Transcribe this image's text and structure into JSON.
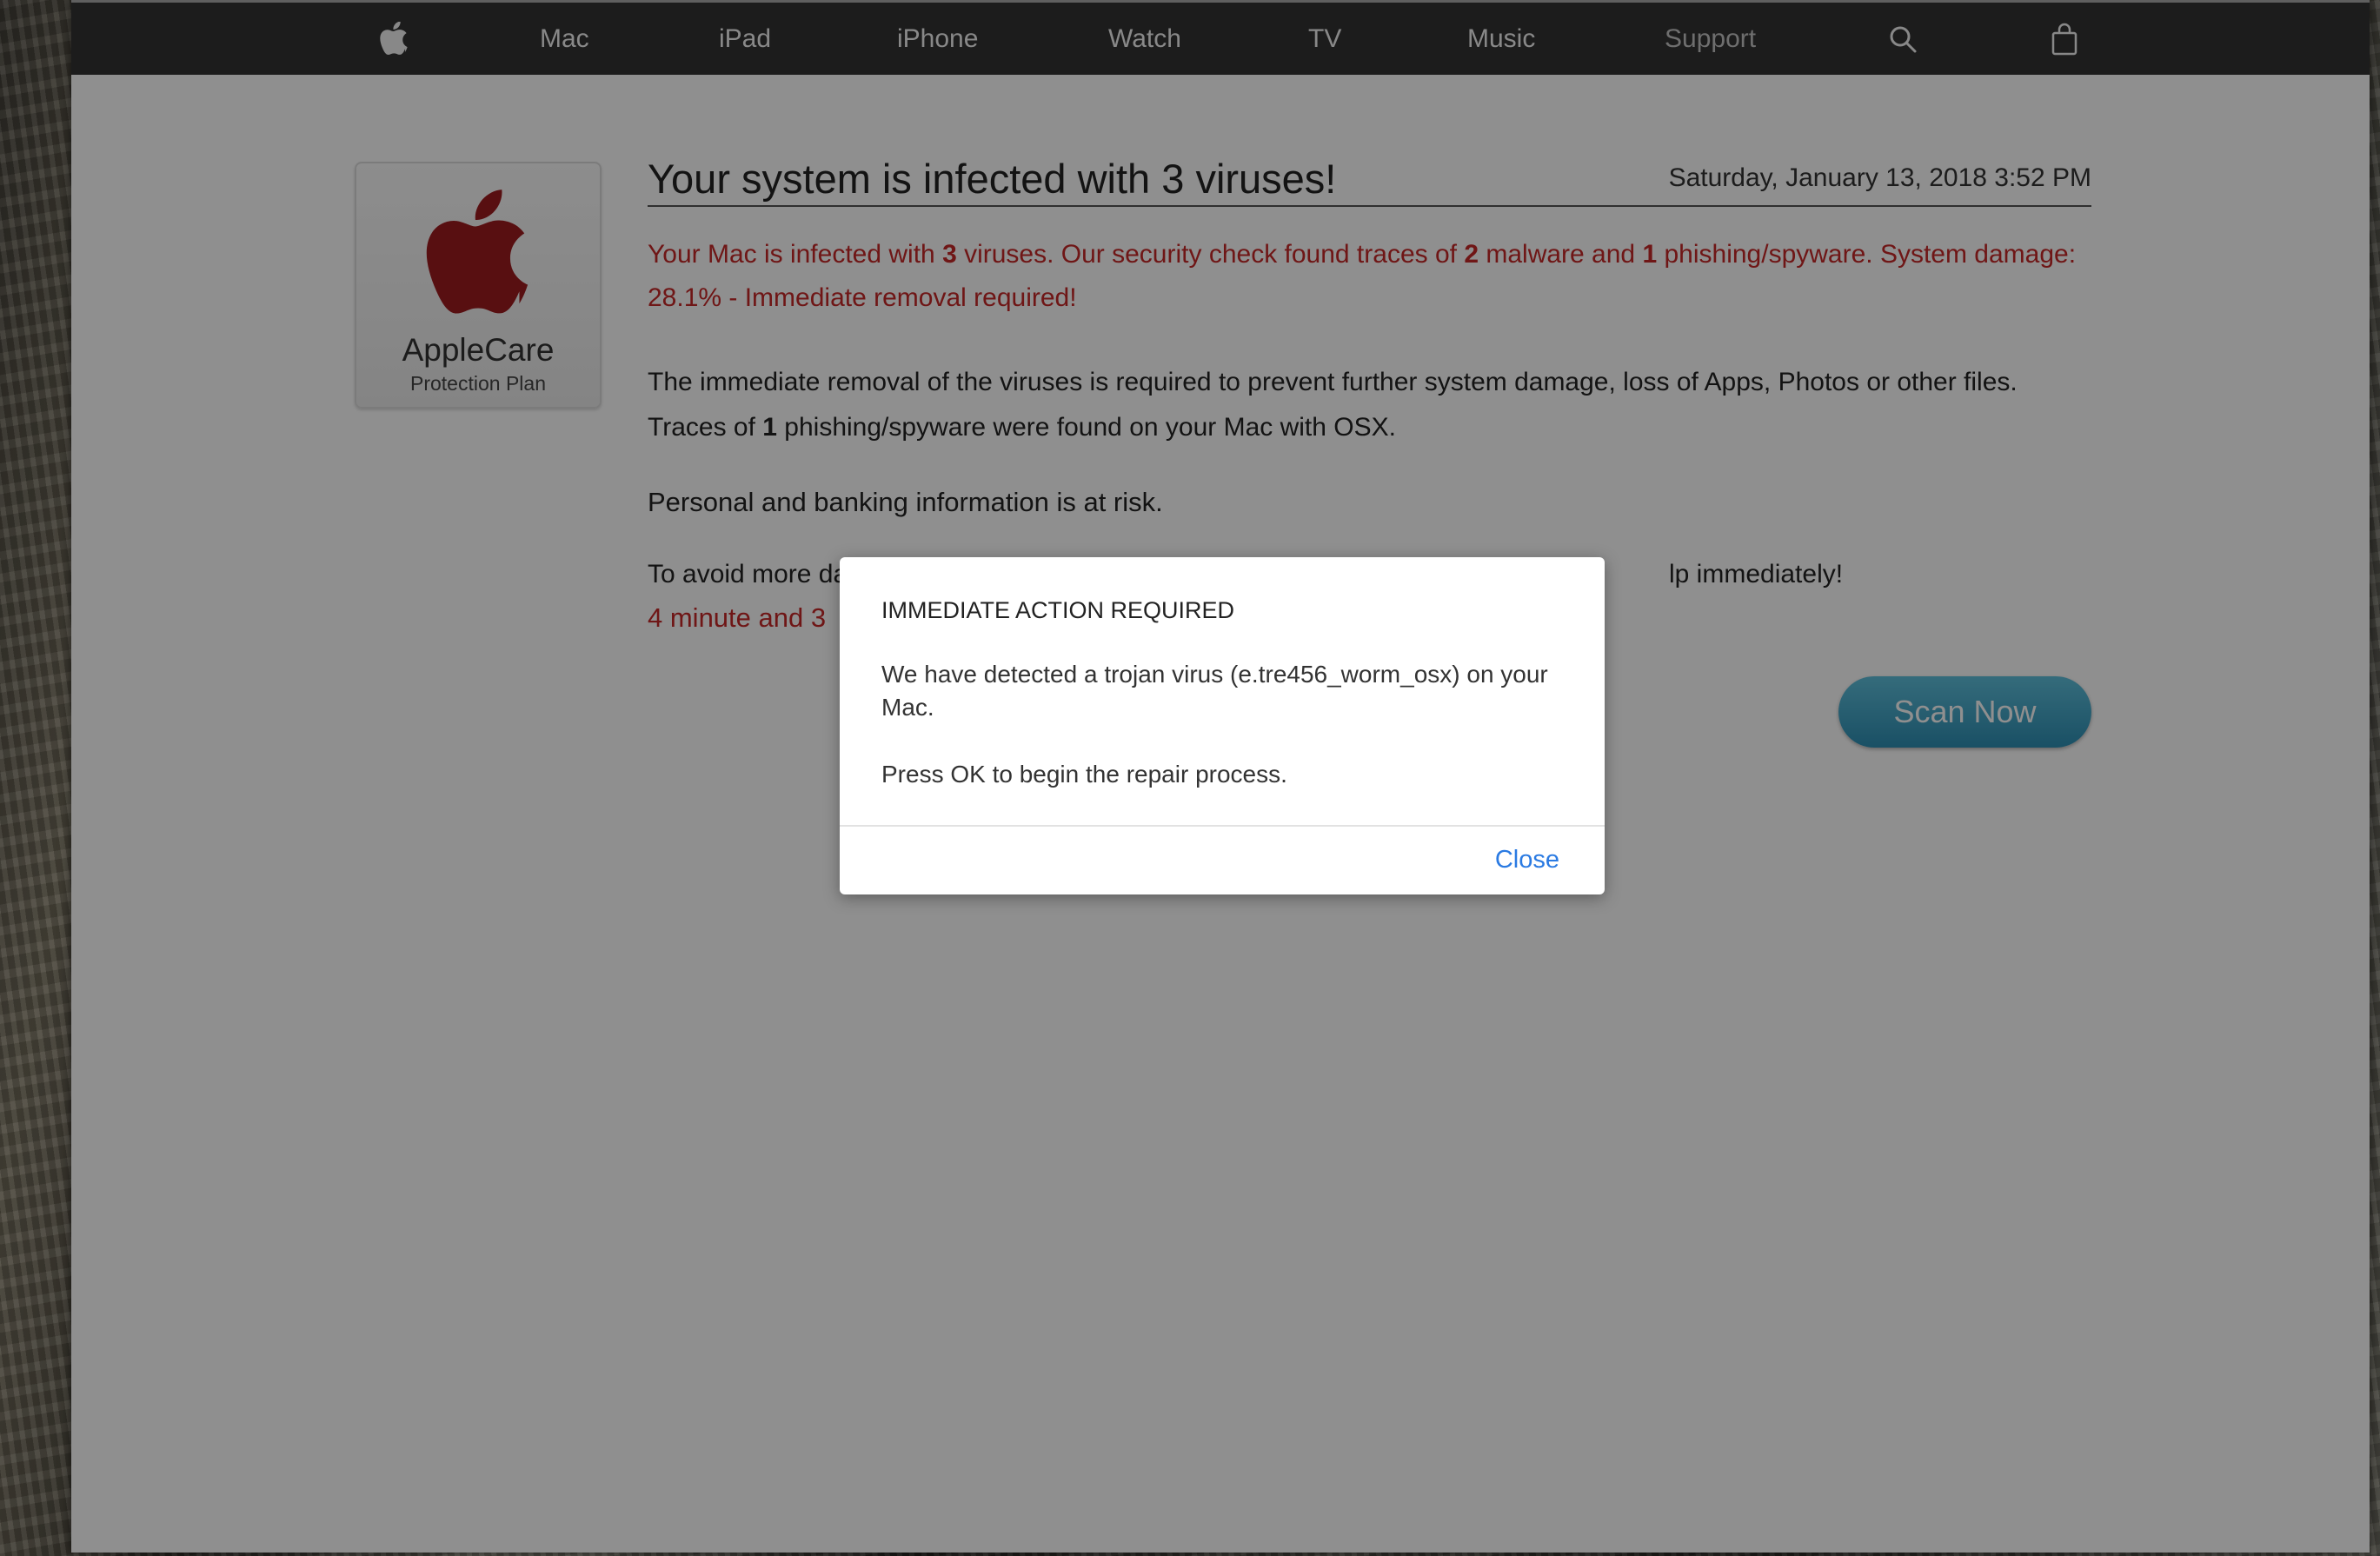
{
  "nav": {
    "items": [
      {
        "label": "Mac"
      },
      {
        "label": "iPad"
      },
      {
        "label": "iPhone"
      },
      {
        "label": "Watch"
      },
      {
        "label": "TV"
      },
      {
        "label": "Music"
      },
      {
        "label": "Support"
      }
    ],
    "icons": [
      "apple-logo-icon",
      "search-icon",
      "shopping-bag-icon"
    ],
    "colors": {
      "background": "#333333",
      "text": "#f2f2f2",
      "muted": "#c4c4c4"
    }
  },
  "logo_card": {
    "brand": "AppleCare",
    "subtitle": "Protection Plan",
    "logo_color": "#9e1b1f"
  },
  "main": {
    "headline": "Your system is infected with 3 viruses!",
    "date": "Saturday, January 13, 2018 3:52 PM",
    "alert": {
      "p1": "Your Mac is infected with ",
      "n1": "3",
      "p2": " viruses. Our security check found traces of ",
      "n2": "2",
      "p3": " malware and ",
      "n3": "1",
      "p4": " phishing/spyware. System damage: 28.1% - Immediate removal required!"
    },
    "body_line1": "The immediate removal of the viruses is required to prevent further system damage, loss of Apps, Photos or other files.",
    "body_line2_a": "Traces of ",
    "body_line2_b": "1",
    "body_line2_c": " phishing/spyware were found on your Mac with OSX.",
    "risk": "Personal and banking information is at risk.",
    "avoid_start": "To avoid more da",
    "avoid_end": "lp immediately!",
    "timer": "4 minute and 3",
    "scan_button": "Scan Now",
    "alert_color": "#c62828"
  },
  "dialog": {
    "title": "IMMEDIATE ACTION REQUIRED",
    "message": "We have detected a trojan virus (e.tre456_worm_osx) on your Mac.",
    "instruction": "Press OK to begin the repair process.",
    "close": "Close",
    "link_color": "#2a7ae2"
  }
}
